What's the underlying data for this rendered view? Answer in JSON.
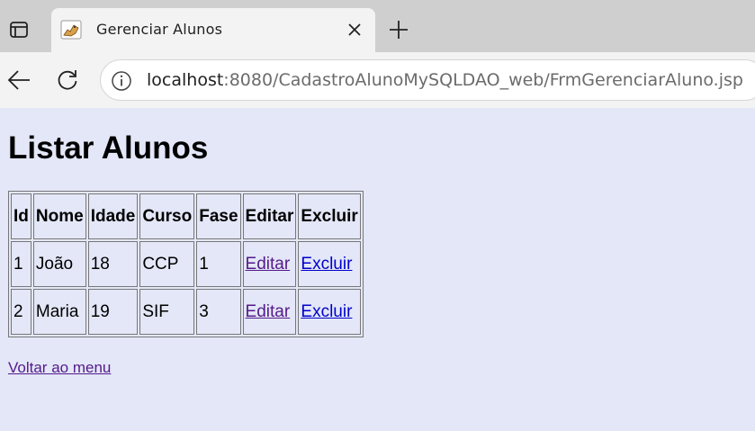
{
  "browser": {
    "tab": {
      "title": "Gerenciar Alunos",
      "favicon": "tomcat-icon"
    },
    "address": {
      "host": "localhost",
      "path": ":8080/CadastroAlunoMySQLDAO_web/FrmGerenciarAluno.jsp"
    }
  },
  "page": {
    "title": "Listar Alunos",
    "table": {
      "headers": [
        "Id",
        "Nome",
        "Idade",
        "Curso",
        "Fase",
        "Editar",
        "Excluir"
      ],
      "rows": [
        {
          "id": "1",
          "nome": "João",
          "idade": "18",
          "curso": "CCP",
          "fase": "1",
          "editar": "Editar",
          "excluir": "Excluir"
        },
        {
          "id": "2",
          "nome": "Maria",
          "idade": "19",
          "curso": "SIF",
          "fase": "3",
          "editar": "Editar",
          "excluir": "Excluir"
        }
      ]
    },
    "back_link": "Voltar ao menu"
  },
  "colors": {
    "page_background": "#e3e7f7",
    "link": "#0000cc",
    "visited_link": "#551a8b"
  }
}
